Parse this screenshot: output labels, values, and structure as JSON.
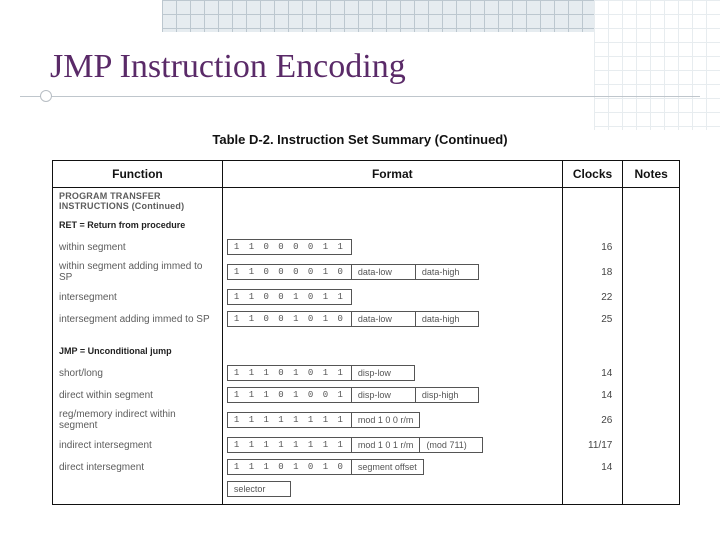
{
  "title": "JMP Instruction Encoding",
  "caption": "Table D-2.  Instruction Set Summary (Continued)",
  "columns": {
    "c0": "Function",
    "c1": "Format",
    "c2": "Clocks",
    "c3": "Notes"
  },
  "section": "PROGRAM TRANSFER INSTRUCTIONS (Continued)",
  "groups": [
    {
      "head": "RET = Return from procedure",
      "rows": [
        {
          "func": "within segment",
          "op": "1 1 0 0 0 0 1 1",
          "f1": "",
          "f2": "",
          "clk": "16"
        },
        {
          "func": "within segment adding immed to SP",
          "op": "1 1 0 0 0 0 1 0",
          "f1": "data-low",
          "f2": "data-high",
          "clk": "18"
        },
        {
          "func": "intersegment",
          "op": "1 1 0 0 1 0 1 1",
          "f1": "",
          "f2": "",
          "clk": "22"
        },
        {
          "func": "intersegment adding immed to SP",
          "op": "1 1 0 0 1 0 1 0",
          "f1": "data-low",
          "f2": "data-high",
          "clk": "25"
        }
      ]
    },
    {
      "head": "JMP = Unconditional jump",
      "rows": [
        {
          "func": "short/long",
          "op": "1 1 1 0 1 0 1 1",
          "f1": "disp-low",
          "f2": "",
          "clk": "14"
        },
        {
          "func": "direct within segment",
          "op": "1 1 1 0 1 0 0 1",
          "f1": "disp-low",
          "f2": "disp-high",
          "clk": "14"
        },
        {
          "func": "reg/memory indirect within segment",
          "op": "1 1 1 1 1 1 1 1",
          "f1": "mod 1 0 0 r/m",
          "f2": "",
          "clk": "26"
        },
        {
          "func": "indirect intersegment",
          "op": "1 1 1 1 1 1 1 1",
          "f1": "mod 1 0 1 r/m",
          "f2": "(mod 711)",
          "clk": "11/17"
        },
        {
          "func": "direct intersegment",
          "op": "1 1 1 0 1 0 1 0",
          "f1": "segment offset",
          "f2": "",
          "clk": "14"
        },
        {
          "func": "",
          "op": "",
          "f1": "selector",
          "f2": "",
          "clk": ""
        }
      ]
    }
  ]
}
